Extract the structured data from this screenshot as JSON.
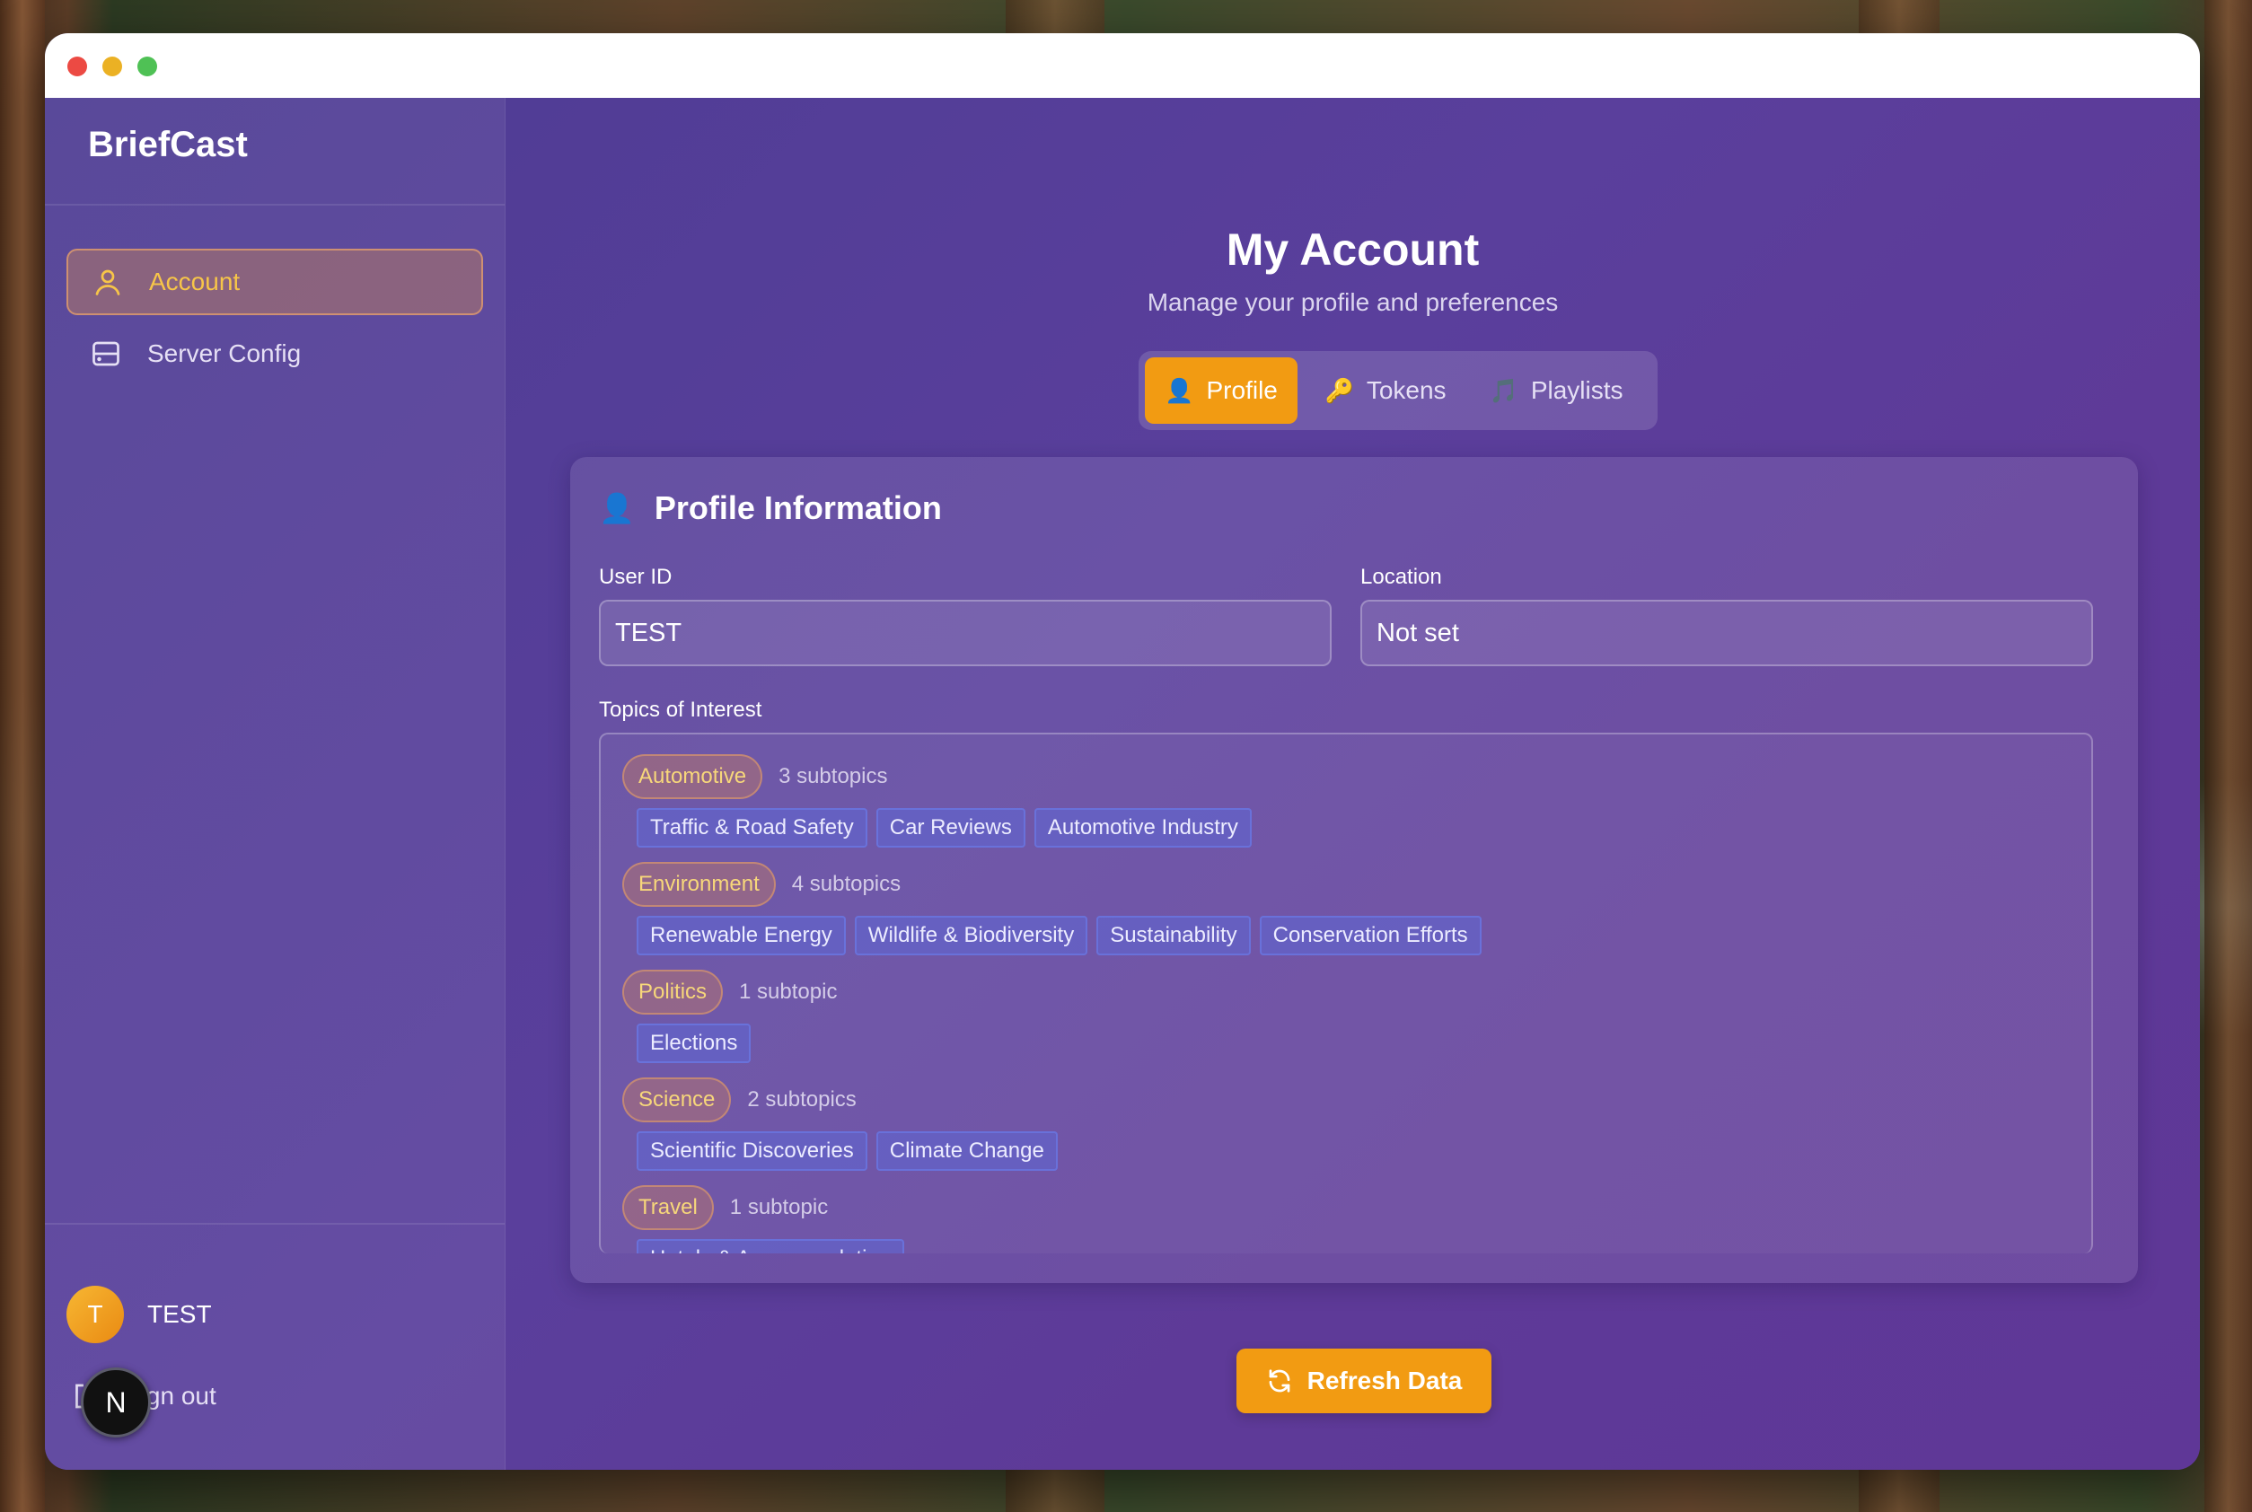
{
  "app": {
    "name": "BriefCast"
  },
  "sidebar": {
    "items": [
      {
        "label": "Account",
        "icon": "user-icon",
        "active": true
      },
      {
        "label": "Server Config",
        "icon": "server-icon",
        "active": false
      }
    ],
    "user": {
      "initial": "T",
      "name": "TEST"
    },
    "signout_label": "Sign out",
    "floating_badge": "N"
  },
  "page": {
    "title": "My Account",
    "subtitle": "Manage your profile and preferences"
  },
  "tabs": [
    {
      "label": "Profile",
      "icon": "👤",
      "active": true
    },
    {
      "label": "Tokens",
      "icon": "🔑",
      "active": false
    },
    {
      "label": "Playlists",
      "icon": "🎵",
      "active": false
    }
  ],
  "profile": {
    "section_icon": "👤",
    "section_title": "Profile Information",
    "user_id_label": "User ID",
    "user_id_value": "TEST",
    "location_label": "Location",
    "location_value": "Not set",
    "topics_label": "Topics of Interest",
    "topics": [
      {
        "name": "Automotive",
        "count": "3 subtopics",
        "subtopics": [
          "Traffic & Road Safety",
          "Car Reviews",
          "Automotive Industry"
        ]
      },
      {
        "name": "Environment",
        "count": "4 subtopics",
        "subtopics": [
          "Renewable Energy",
          "Wildlife & Biodiversity",
          "Sustainability",
          "Conservation Efforts"
        ]
      },
      {
        "name": "Politics",
        "count": "1 subtopic",
        "subtopics": [
          "Elections"
        ]
      },
      {
        "name": "Science",
        "count": "2 subtopics",
        "subtopics": [
          "Scientific Discoveries",
          "Climate Change"
        ]
      },
      {
        "name": "Travel",
        "count": "1 subtopic",
        "subtopics": [
          "Hotels & Accommodation"
        ]
      }
    ]
  },
  "actions": {
    "refresh_label": "Refresh Data"
  },
  "colors": {
    "accent": "#f29b12",
    "active_nav_text": "#f7c548",
    "chip": "#586ee6"
  }
}
